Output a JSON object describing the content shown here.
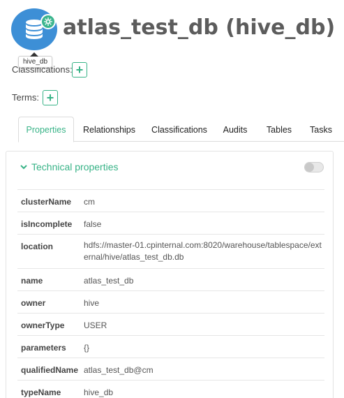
{
  "entity": {
    "title": "atlas_test_db (hive_db)",
    "icon": "database-icon",
    "badge_icon": "gear-icon",
    "tooltip": "hive_db"
  },
  "labels": {
    "classifications": "Classifications:",
    "terms": "Terms:"
  },
  "tabs": [
    {
      "label": "Properties",
      "active": true
    },
    {
      "label": "Relationships"
    },
    {
      "label": "Classifications"
    },
    {
      "label": "Audits"
    },
    {
      "label": "Tables"
    },
    {
      "label": "Tasks"
    }
  ],
  "panel": {
    "title": "Technical properties",
    "toggle_on": false
  },
  "properties": [
    {
      "key": "clusterName",
      "value": "cm"
    },
    {
      "key": "isIncomplete",
      "value": "false"
    },
    {
      "key": "location",
      "value": "hdfs://master-01.cpinternal.com:8020/warehouse/tablespace/external/hive/atlas_test_db.db"
    },
    {
      "key": "name",
      "value": "atlas_test_db"
    },
    {
      "key": "owner",
      "value": "hive"
    },
    {
      "key": "ownerType",
      "value": "USER"
    },
    {
      "key": "parameters",
      "value": "{}"
    },
    {
      "key": "qualifiedName",
      "value": "atlas_test_db@cm"
    },
    {
      "key": "typeName",
      "value": "hive_db"
    }
  ],
  "colors": {
    "accent": "#38b387",
    "icon_bg": "#3d8fd6"
  }
}
